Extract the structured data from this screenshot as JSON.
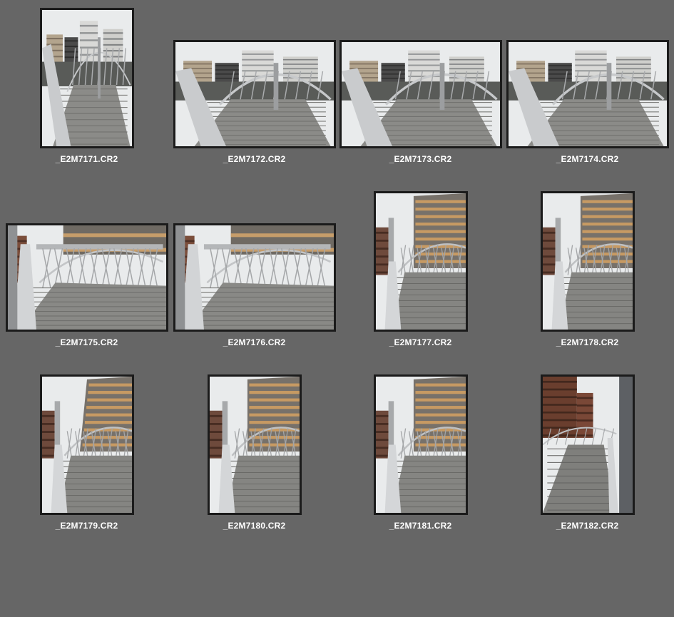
{
  "browser": {
    "thumbnails": [
      {
        "filename": "_E2M7171.CR2",
        "orientation": "portrait",
        "scene": "bridge-level-buildings"
      },
      {
        "filename": "_E2M7172.CR2",
        "orientation": "landscape",
        "scene": "bridge-arch-buildings"
      },
      {
        "filename": "_E2M7173.CR2",
        "orientation": "landscape",
        "scene": "bridge-arch-buildings"
      },
      {
        "filename": "_E2M7174.CR2",
        "orientation": "landscape",
        "scene": "bridge-arch-buildings"
      },
      {
        "filename": "_E2M7175.CR2",
        "orientation": "landscape",
        "scene": "bridge-truss-building"
      },
      {
        "filename": "_E2M7176.CR2",
        "orientation": "landscape",
        "scene": "bridge-truss-close"
      },
      {
        "filename": "_E2M7177.CR2",
        "orientation": "portrait",
        "scene": "bridge-tower"
      },
      {
        "filename": "_E2M7178.CR2",
        "orientation": "portrait",
        "scene": "bridge-tower"
      },
      {
        "filename": "_E2M7179.CR2",
        "orientation": "portrait",
        "scene": "bridge-tower-tilted"
      },
      {
        "filename": "_E2M7180.CR2",
        "orientation": "portrait",
        "scene": "bridge-tower"
      },
      {
        "filename": "_E2M7181.CR2",
        "orientation": "portrait",
        "scene": "bridge-tower"
      },
      {
        "filename": "_E2M7182.CR2",
        "orientation": "portrait",
        "scene": "bridge-walkway-brick"
      }
    ]
  }
}
